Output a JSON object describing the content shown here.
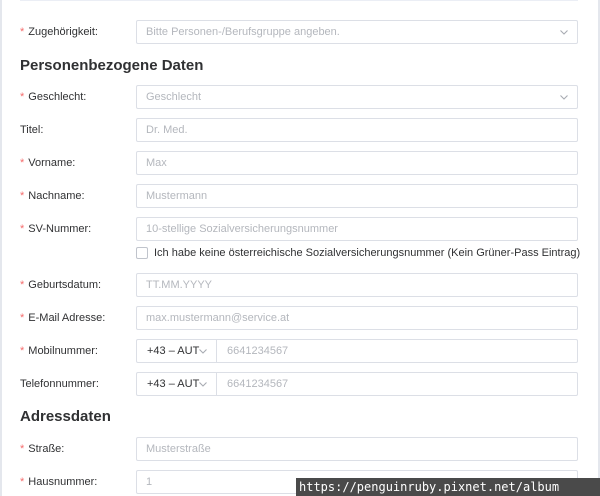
{
  "form": {
    "zugehoerigkeit": {
      "label": "Zugehörigkeit:",
      "placeholder": "Bitte Personen-/Berufsgruppe angeben."
    },
    "section_personal": "Personenbezogene Daten",
    "geschlecht": {
      "label": "Geschlecht:",
      "placeholder": "Geschlecht"
    },
    "titel": {
      "label": "Titel:",
      "placeholder": "Dr. Med."
    },
    "vorname": {
      "label": "Vorname:",
      "placeholder": "Max"
    },
    "nachname": {
      "label": "Nachname:",
      "placeholder": "Mustermann"
    },
    "sv_nummer": {
      "label": "SV-Nummer:",
      "placeholder": "10-stellige Sozialversicherungsnummer"
    },
    "no_sv_checkbox": {
      "label": "Ich habe keine österreichische Sozialversicherungsnummer (Kein Grüner-Pass Eintrag)",
      "checked": false
    },
    "geburtsdatum": {
      "label": "Geburtsdatum:",
      "placeholder": "TT.MM.YYYY"
    },
    "email": {
      "label": "E-Mail Adresse:",
      "placeholder": "max.mustermann@service.at"
    },
    "mobilnummer": {
      "label": "Mobilnummer:",
      "country_code": "+43 – AUT",
      "placeholder": "6641234567"
    },
    "telefonnummer": {
      "label": "Telefonnummer:",
      "country_code": "+43 – AUT",
      "placeholder": "6641234567"
    },
    "section_address": "Adressdaten",
    "strasse": {
      "label": "Straße:",
      "placeholder": "Musterstraße"
    },
    "hausnummer": {
      "label": "Hausnummer:",
      "placeholder": "1"
    }
  },
  "required_marker": "*",
  "watermark": "https://penguinruby.pixnet.net/album",
  "colors": {
    "required": "#f56c6c",
    "border": "#dcdfe6",
    "placeholder": "#b4b7bd",
    "text": "#303133"
  },
  "icons": {
    "select_arrow": "chevron-down-icon"
  }
}
